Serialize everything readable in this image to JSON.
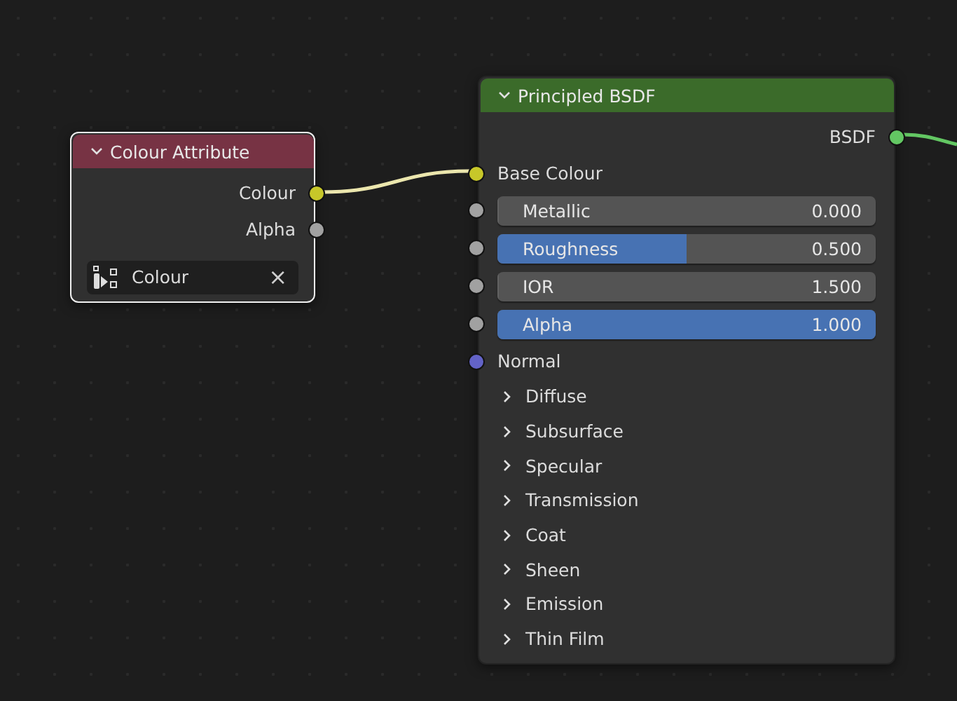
{
  "nodes": [
    {
      "title": "Colour Attribute",
      "color": "#773344",
      "selected": true,
      "expanded": true,
      "outputs": [
        {
          "label": "Colour",
          "color": "#c7c729"
        },
        {
          "label": "Alpha",
          "color": "#a1a1a1"
        }
      ],
      "field": {
        "value": "Colour",
        "clear_icon": "×"
      }
    },
    {
      "title": "Principled BSDF",
      "color": "#3b6b2a",
      "selected": false,
      "expanded": true,
      "outputs": [
        {
          "label": "BSDF",
          "color": "#63c763"
        }
      ],
      "inputs": [
        {
          "kind": "socket",
          "label": "Base Colour",
          "color": "#c7c729"
        },
        {
          "kind": "slider",
          "label": "Metallic",
          "value": "0.000",
          "level": 0,
          "color": "#a1a1a1"
        },
        {
          "kind": "slider",
          "label": "Roughness",
          "value": "0.500",
          "level": 0.5,
          "color": "#a1a1a1"
        },
        {
          "kind": "slider",
          "label": "IOR",
          "value": "1.500",
          "level": 0,
          "color": "#a1a1a1"
        },
        {
          "kind": "slider",
          "label": "Alpha",
          "value": "1.000",
          "level": 1,
          "color": "#a1a1a1"
        },
        {
          "kind": "socket",
          "label": "Normal",
          "color": "#6363c7"
        }
      ],
      "panels": [
        {
          "label": "Diffuse",
          "expanded": false
        },
        {
          "label": "Subsurface",
          "expanded": false
        },
        {
          "label": "Specular",
          "expanded": false
        },
        {
          "label": "Transmission",
          "expanded": false
        },
        {
          "label": "Coat",
          "expanded": false
        },
        {
          "label": "Sheen",
          "expanded": false
        },
        {
          "label": "Emission",
          "expanded": false
        },
        {
          "label": "Thin Film",
          "expanded": false
        }
      ]
    }
  ]
}
